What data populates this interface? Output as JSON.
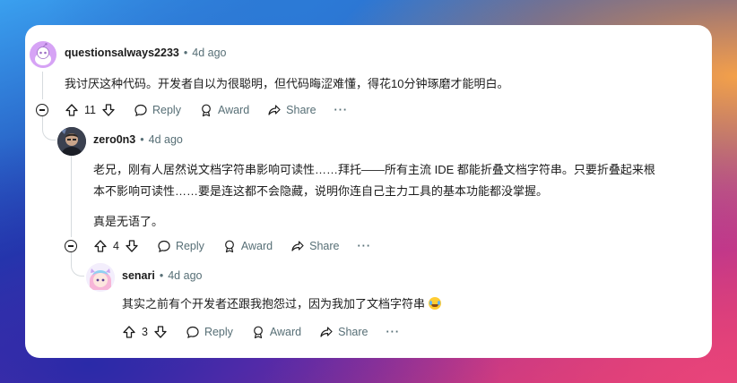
{
  "comments": [
    {
      "author": "questionsalways2233",
      "time": "4d ago",
      "lines": [
        "我讨厌这种代码。开发者自以为很聪明，但代码晦涩难懂，得花10分钟琢磨才能明白。"
      ],
      "votes": "11",
      "avatar_icon": "reddit-snoo-default-avatar"
    },
    {
      "author": "zero0n3",
      "time": "4d ago",
      "lines": [
        "老兄，刚有人居然说文档字符串影响可读性……拜托——所有主流 IDE 都能折叠文档字符串。只要折叠起来根",
        "本不影响可读性……要是连这都不会隐藏，说明你连自己主力工具的基本功能都没掌握。",
        "",
        "真是无语了。"
      ],
      "votes": "4",
      "avatar_icon": "user-photo-avatar"
    },
    {
      "author": "senari",
      "time": "4d ago",
      "lines": [
        "其实之前有个开发者还跟我抱怨过，因为我加了文档字符串"
      ],
      "emoji": "laughing-crying-emoji",
      "votes": "3",
      "avatar_icon": "anime-avatar"
    }
  ],
  "actions": {
    "reply": "Reply",
    "award": "Award",
    "share": "Share",
    "more": "···"
  },
  "separator": "•",
  "colors": {
    "text": "#1c1c1c",
    "meta": "#576f76",
    "thread_line": "#d6dbde",
    "avatar_bg_1": "#d6a3f5"
  }
}
